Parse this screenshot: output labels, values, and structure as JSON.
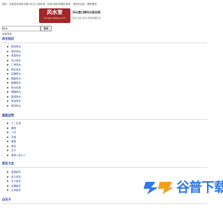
{
  "notice": "您好，欢迎您来到风水堂口文文介绍查询！本站内容仅供娱乐参考，请您勿当真，理性看待。",
  "logo": {
    "name": "风水堂",
    "small": "fengshuitang.com",
    "title": "风水堂口碑风水起名网",
    "subtitle": "起名·测名·风水·周易命理文化"
  },
  "search": {
    "value": "风水",
    "button": "搜索"
  },
  "nav_label": "网站导航",
  "sections": [
    {
      "title": "风水知识",
      "items": [
        "阳宅风水",
        "阴宅风水",
        "家居风水",
        "办公风水",
        "厂房风水",
        "商业风水",
        "店铺风水",
        "楼盘风水",
        "婚姻风水",
        "风水化煞",
        "健康风水",
        "旅游风水",
        "财运风水",
        "城市风水"
      ]
    },
    {
      "title": "星座运势",
      "items": [
        "十二生肖",
        "星座",
        "八字",
        "手相",
        "面相",
        "姓名",
        "五行",
        "周易八卦占卜"
      ]
    },
    {
      "title": "起名大全",
      "items": [
        "宝宝起名",
        "成人改名",
        "艺人起名",
        "店铺起名",
        "公司起名"
      ]
    },
    {
      "title": "白羊子",
      "items": []
    }
  ],
  "watermark": {
    "text": "谷普下载"
  },
  "colors": {
    "link": "#1a3c9e",
    "logo_red": "#a3262a",
    "watermark_blue": "#2f78e8"
  }
}
